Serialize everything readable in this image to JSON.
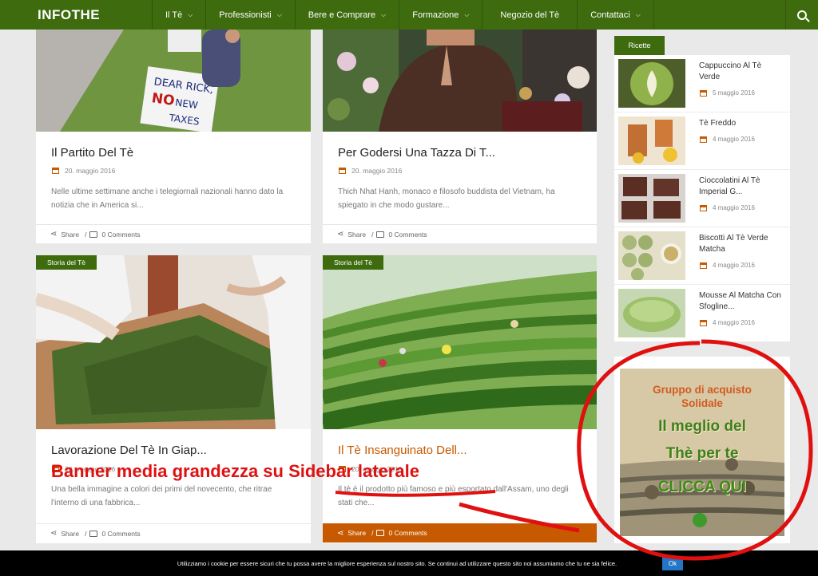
{
  "nav": {
    "logo": "INFOTHE",
    "items": [
      "Il Tè",
      "Professionisti",
      "Bere e Comprare",
      "Formazione",
      "Negozio del Tè",
      "Contattaci"
    ],
    "search_icon": "search-icon"
  },
  "cards": [
    {
      "tag": "",
      "title": "Il Partito Del Tè",
      "date": "20. maggio 2016",
      "excerpt": "Nelle ultime settimane anche i telegiornali nazionali hanno dato la notizia che in America si...",
      "share": "Share",
      "comments": "0 Comments"
    },
    {
      "tag": "",
      "title": "Per Godersi Una Tazza Di T...",
      "date": "20. maggio 2016",
      "excerpt": "Thich Nhat Hanh, monaco e filosofo buddista del Vietnam, ha spiegato in che modo gustare...",
      "share": "Share",
      "comments": "0 Comments"
    },
    {
      "tag": "Storia del Tè",
      "title": "Lavorazione Del Tè In Giap...",
      "date": "20. maggio 2016",
      "excerpt": "Una bella immagine a colori dei primi del novecento, che ritrae l'interno di una fabbrica...",
      "share": "Share",
      "comments": "0 Comments"
    },
    {
      "tag": "Storia del Tè",
      "title": "Il Tè Insanguinato Dell...",
      "date": "20. maggio 2016",
      "excerpt": "Il tè è il prodotto più famoso e più esportato dall'Assam, uno degli stati che...",
      "share": "Share",
      "comments": "0 Comments"
    }
  ],
  "sidebar": {
    "tab": "Ricette",
    "items": [
      {
        "title": "Cappuccino Al Tè Verde",
        "date": "5 maggio 2016"
      },
      {
        "title": "Tè Freddo",
        "date": "4 maggio 2016"
      },
      {
        "title": "Cioccolatini Al Tè Imperial G...",
        "date": "4 maggio 2016"
      },
      {
        "title": "Biscotti Al Tè Verde Matcha",
        "date": "4 maggio 2016"
      },
      {
        "title": "Mousse Al Matcha Con Sfogline...",
        "date": "4 maggio 2016"
      }
    ],
    "banner": {
      "line1": "Gruppo di acquisto",
      "line2": "Solidale",
      "line3": "Il meglio del",
      "line4": "Thè per te",
      "line5": "CLICCA QUI"
    }
  },
  "annotation": "Banner media grandezza su Sidebar laterale",
  "cookie": {
    "text": "Utilizziamo i cookie per essere sicuri che tu possa avere la migliore esperienza sul nostro sito. Se continui ad utilizzare questo sito noi assumiamo che tu ne sia felice.",
    "ok": "Ok"
  },
  "colors": {
    "nav": "#3d6b0e",
    "accent": "#c75a00",
    "annotation": "#e01010"
  }
}
